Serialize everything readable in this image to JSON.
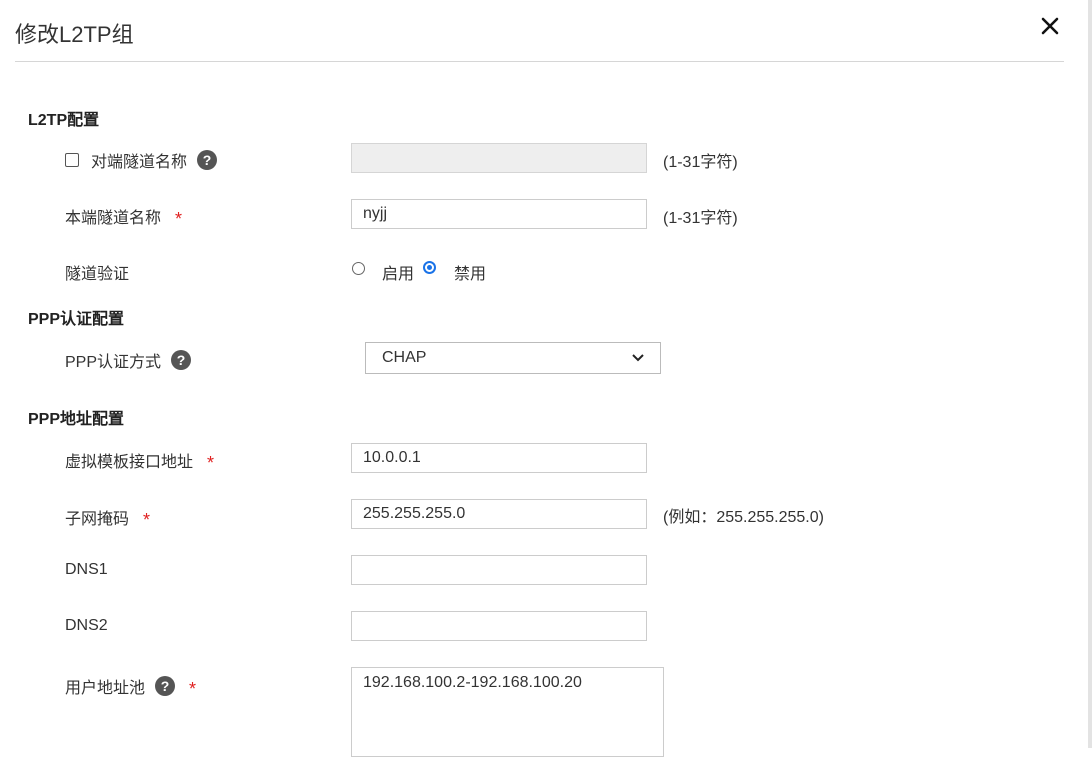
{
  "dialog": {
    "title": "修改L2TP组"
  },
  "l2tp": {
    "section_title": "L2TP配置",
    "peer_tunnel_name": {
      "label": "对端隧道名称",
      "value": "",
      "hint": "(1-31字符)",
      "checked": false
    },
    "local_tunnel_name": {
      "label": "本端隧道名称",
      "value": "nyjj",
      "hint": "(1-31字符)",
      "required_mark": "*"
    },
    "tunnel_auth": {
      "label": "隧道验证",
      "options": [
        "启用",
        "禁用"
      ],
      "selected": "禁用"
    }
  },
  "ppp_auth": {
    "section_title": "PPP认证配置",
    "method": {
      "label": "PPP认证方式",
      "value": "CHAP"
    }
  },
  "ppp_addr": {
    "section_title": "PPP地址配置",
    "vt_ip": {
      "label": "虚拟模板接口地址",
      "value": "10.0.0.1",
      "required_mark": "*"
    },
    "mask": {
      "label": "子网掩码",
      "value": "255.255.255.0",
      "hint": "(例如：255.255.255.0)",
      "required_mark": "*"
    },
    "dns1": {
      "label": "DNS1",
      "value": ""
    },
    "dns2": {
      "label": "DNS2",
      "value": ""
    },
    "pool": {
      "label": "用户地址池",
      "value": "192.168.100.2-192.168.100.20",
      "required_mark": "*"
    }
  },
  "icons": {
    "help": "?",
    "close": "close-icon",
    "chevron": "chevron-down-icon"
  },
  "colors": {
    "required": "#e02020",
    "radio_accent": "#1a73e8",
    "help_icon_bg": "#555555"
  }
}
